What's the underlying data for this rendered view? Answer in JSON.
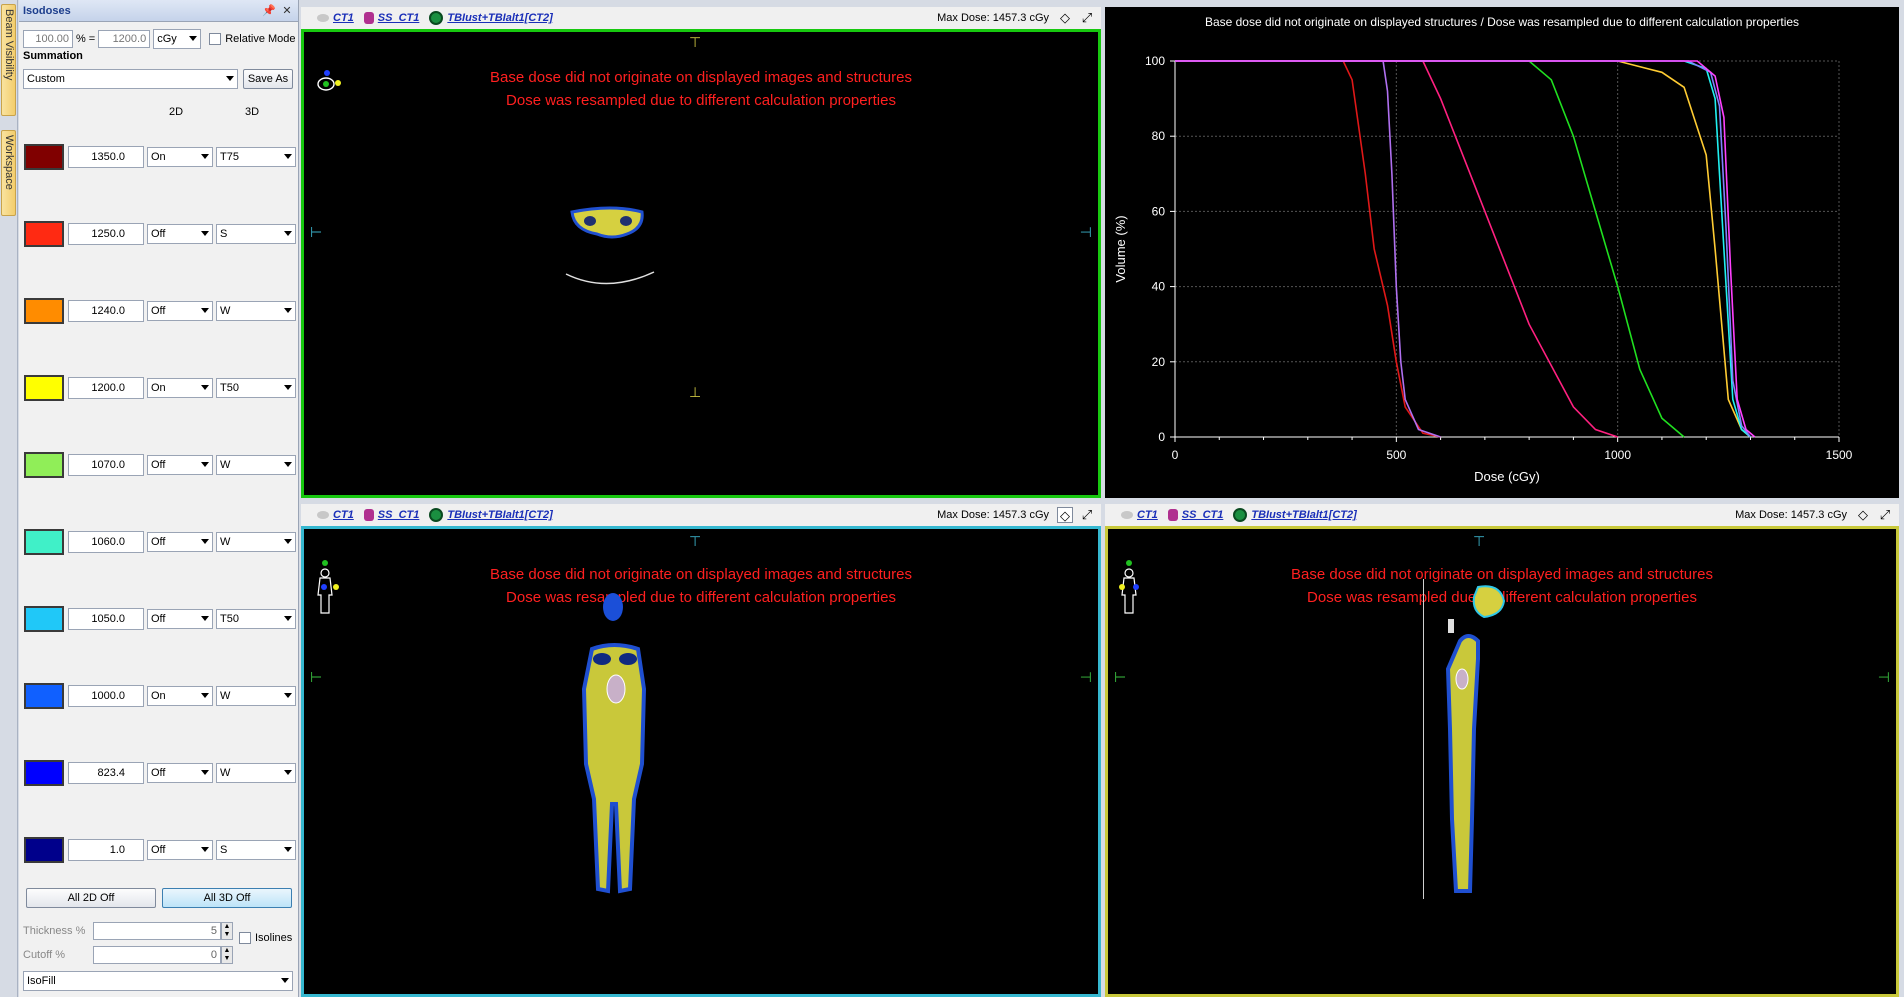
{
  "side_tabs": [
    "Beam Visibility",
    "Workspace"
  ],
  "isodose_panel": {
    "title": "Isodoses",
    "percent_value": "100.00",
    "percent_sign": "%",
    "equals": "=",
    "dose_value": "1200.0",
    "unit": "cGy",
    "relative_mode_label": "Relative Mode",
    "summation_label": "Summation",
    "preset": "Custom",
    "save_as_label": "Save As",
    "col_2d": "2D",
    "col_3d": "3D",
    "levels": [
      {
        "color": "#800000",
        "value": "1350.0",
        "mode2d": "On",
        "mode3d": "T75"
      },
      {
        "color": "#ff2a12",
        "value": "1250.0",
        "mode2d": "Off",
        "mode3d": "S"
      },
      {
        "color": "#ff8c00",
        "value": "1240.0",
        "mode2d": "Off",
        "mode3d": "W"
      },
      {
        "color": "#ffff00",
        "value": "1200.0",
        "mode2d": "On",
        "mode3d": "T50"
      },
      {
        "color": "#90ee58",
        "value": "1070.0",
        "mode2d": "Off",
        "mode3d": "W"
      },
      {
        "color": "#40f0c8",
        "value": "1060.0",
        "mode2d": "Off",
        "mode3d": "W"
      },
      {
        "color": "#20c8f8",
        "value": "1050.0",
        "mode2d": "Off",
        "mode3d": "T50"
      },
      {
        "color": "#1060ff",
        "value": "1000.0",
        "mode2d": "On",
        "mode3d": "W"
      },
      {
        "color": "#0000ff",
        "value": "823.4",
        "mode2d": "Off",
        "mode3d": "W"
      },
      {
        "color": "#00008b",
        "value": "1.0",
        "mode2d": "Off",
        "mode3d": "S"
      }
    ],
    "all_2d_off": "All 2D Off",
    "all_3d_off": "All 3D Off",
    "thickness_label": "Thickness %",
    "thickness_value": "5",
    "isolines_label": "Isolines",
    "cutoff_label": "Cutoff %",
    "cutoff_value": "0",
    "fill_mode": "IsoFill"
  },
  "viewport_header": {
    "ct": "CT1",
    "ss": "SS_CT1",
    "plan": "TBIust+TBIalt1[CT2]",
    "max_dose": "Max Dose: 1457.3 cGy"
  },
  "warning": {
    "line1": "Base dose did not originate on displayed images and structures",
    "line2": "Dose was resampled due to different calculation properties"
  },
  "dvh_title": "Base dose did not originate on displayed structures / Dose was resampled due to different calculation properties",
  "chart_data": {
    "type": "line",
    "title": "",
    "xlabel": "Dose (cGy)",
    "ylabel": "Volume (%)",
    "xlim": [
      0,
      1500
    ],
    "ylim": [
      0,
      100
    ],
    "xticks": [
      "0",
      "500",
      "1000",
      "1500"
    ],
    "yticks": [
      "0",
      "20",
      "40",
      "60",
      "80",
      "100"
    ],
    "grid": true,
    "series": [
      {
        "color": "#e01818",
        "x": [
          0,
          380,
          400,
          430,
          450,
          480,
          500,
          520,
          560,
          600
        ],
        "y": [
          100,
          100,
          95,
          70,
          50,
          35,
          20,
          8,
          1,
          0
        ]
      },
      {
        "color": "#b070f0",
        "x": [
          0,
          470,
          480,
          490,
          500,
          510,
          520,
          550,
          600
        ],
        "y": [
          100,
          100,
          92,
          70,
          40,
          20,
          10,
          2,
          0
        ]
      },
      {
        "color": "#ff2080",
        "x": [
          0,
          560,
          600,
          700,
          800,
          900,
          950,
          1000
        ],
        "y": [
          100,
          100,
          90,
          60,
          30,
          8,
          2,
          0
        ]
      },
      {
        "color": "#20e020",
        "x": [
          0,
          800,
          850,
          900,
          950,
          1000,
          1050,
          1100,
          1150
        ],
        "y": [
          100,
          100,
          95,
          80,
          60,
          40,
          18,
          5,
          0
        ]
      },
      {
        "color": "#ffcc33",
        "x": [
          0,
          1000,
          1100,
          1150,
          1200,
          1220,
          1250,
          1280,
          1300
        ],
        "y": [
          100,
          100,
          97,
          93,
          75,
          50,
          10,
          2,
          0
        ]
      },
      {
        "color": "#20f0f0",
        "x": [
          0,
          1150,
          1200,
          1220,
          1240,
          1260,
          1280,
          1300
        ],
        "y": [
          100,
          100,
          98,
          90,
          50,
          10,
          2,
          0
        ]
      },
      {
        "color": "#8080ff",
        "x": [
          0,
          1160,
          1210,
          1230,
          1245,
          1260,
          1280,
          1300
        ],
        "y": [
          100,
          100,
          97,
          88,
          55,
          15,
          3,
          0
        ]
      },
      {
        "color": "#ff40ff",
        "x": [
          0,
          1180,
          1220,
          1240,
          1255,
          1270,
          1290,
          1310
        ],
        "y": [
          100,
          100,
          96,
          85,
          45,
          10,
          2,
          0
        ]
      }
    ]
  }
}
